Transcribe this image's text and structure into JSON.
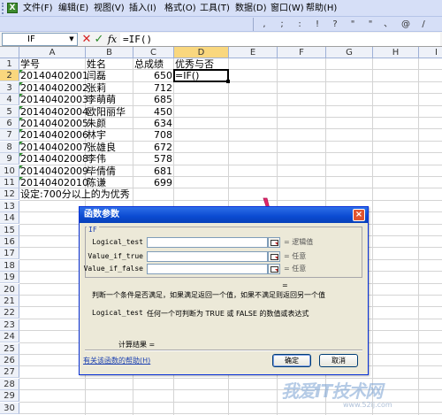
{
  "menubar": {
    "items": [
      "文件(F)",
      "编辑(E)",
      "视图(V)",
      "插入(I)",
      "格式(O)",
      "工具(T)",
      "数据(D)",
      "窗口(W)",
      "帮助(H)"
    ]
  },
  "toolbar": {
    "glyphs": [
      ",",
      ";",
      ":",
      "!",
      "?",
      "\"",
      "\"",
      "、",
      "@",
      "/"
    ]
  },
  "formula_bar": {
    "name_box": "IF",
    "fx_label": "fx",
    "content": "=IF()"
  },
  "sheet": {
    "columns": [
      "A",
      "B",
      "C",
      "D",
      "E",
      "F",
      "G",
      "H",
      "I"
    ],
    "active_column": "D",
    "active_row": 2,
    "rows": [
      {
        "num": "1",
        "a": "学号",
        "b": "姓名",
        "c": "总成绩",
        "d": "优秀与否"
      },
      {
        "num": "2",
        "a": "20140402001",
        "b": "闫磊",
        "c": "650",
        "d": "=IF()"
      },
      {
        "num": "3",
        "a": "20140402002",
        "b": "张莉",
        "c": "712",
        "d": ""
      },
      {
        "num": "4",
        "a": "20140402003",
        "b": "李萌萌",
        "c": "685",
        "d": ""
      },
      {
        "num": "5",
        "a": "20140402004",
        "b": "欧阳丽华",
        "c": "450",
        "d": ""
      },
      {
        "num": "6",
        "a": "20140402005",
        "b": "朱颜",
        "c": "634",
        "d": ""
      },
      {
        "num": "7",
        "a": "20140402006",
        "b": "林宇",
        "c": "708",
        "d": ""
      },
      {
        "num": "8",
        "a": "20140402007",
        "b": "张雄良",
        "c": "672",
        "d": ""
      },
      {
        "num": "9",
        "a": "20140402008",
        "b": "李伟",
        "c": "578",
        "d": ""
      },
      {
        "num": "10",
        "a": "20140402009",
        "b": "毕倩倩",
        "c": "681",
        "d": ""
      },
      {
        "num": "11",
        "a": "20140402010",
        "b": "陈谦",
        "c": "699",
        "d": ""
      },
      {
        "num": "12",
        "a": "设定:700分以上的为优秀",
        "b": "",
        "c": "",
        "d": ""
      },
      {
        "num": "13",
        "a": "",
        "b": "",
        "c": "",
        "d": ""
      },
      {
        "num": "14",
        "a": "",
        "b": "",
        "c": "",
        "d": ""
      },
      {
        "num": "15",
        "a": "",
        "b": "",
        "c": "",
        "d": ""
      },
      {
        "num": "16",
        "a": "",
        "b": "",
        "c": "",
        "d": ""
      },
      {
        "num": "17",
        "a": "",
        "b": "",
        "c": "",
        "d": ""
      },
      {
        "num": "18",
        "a": "",
        "b": "",
        "c": "",
        "d": ""
      },
      {
        "num": "19",
        "a": "",
        "b": "",
        "c": "",
        "d": ""
      },
      {
        "num": "20",
        "a": "",
        "b": "",
        "c": "",
        "d": ""
      },
      {
        "num": "21",
        "a": "",
        "b": "",
        "c": "",
        "d": ""
      },
      {
        "num": "22",
        "a": "",
        "b": "",
        "c": "",
        "d": ""
      },
      {
        "num": "23",
        "a": "",
        "b": "",
        "c": "",
        "d": ""
      },
      {
        "num": "24",
        "a": "",
        "b": "",
        "c": "",
        "d": ""
      },
      {
        "num": "25",
        "a": "",
        "b": "",
        "c": "",
        "d": ""
      },
      {
        "num": "26",
        "a": "",
        "b": "",
        "c": "",
        "d": ""
      },
      {
        "num": "27",
        "a": "",
        "b": "",
        "c": "",
        "d": ""
      },
      {
        "num": "28",
        "a": "",
        "b": "",
        "c": "",
        "d": ""
      },
      {
        "num": "29",
        "a": "",
        "b": "",
        "c": "",
        "d": ""
      },
      {
        "num": "30",
        "a": "",
        "b": "",
        "c": "",
        "d": ""
      }
    ]
  },
  "dialog": {
    "title": "函数参数",
    "close_label": "×",
    "function_name": "IF",
    "args": [
      {
        "label": "Logical_test",
        "value": "",
        "result": "= 逻辑值"
      },
      {
        "label": "Value_if_true",
        "value": "",
        "result": "= 任意"
      },
      {
        "label": "Value_if_false",
        "value": "",
        "result": "= 任意"
      }
    ],
    "equals": "=",
    "description": "判断一个条件是否满足，如果满足返回一个值，如果不满足则返回另一个值",
    "current_arg_name": "Logical_test",
    "current_arg_desc": "任何一个可判断为 TRUE 或 FALSE 的数值或表达式",
    "result_label": "计算结果 =",
    "help_link": "有关该函数的帮助(H)",
    "ok_label": "确定",
    "cancel_label": "取消"
  },
  "watermark": {
    "text": "我爱IT技术网",
    "url": "www.52ij.com"
  },
  "colors": {
    "menubar_bg": "#d6dff7",
    "dialog_title": "#0a4ad1",
    "dialog_bg": "#ece9d8",
    "arrow": "#e0266b",
    "error_indicator": "#2f8f2f"
  }
}
